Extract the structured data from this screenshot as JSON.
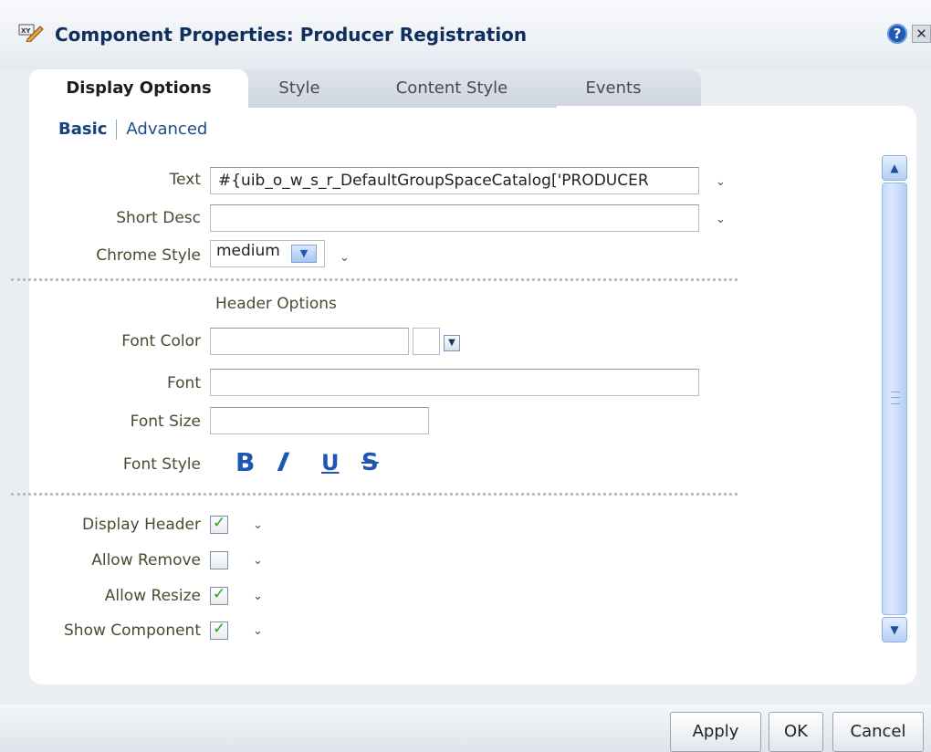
{
  "dialog": {
    "title": "Component Properties: Producer Registration",
    "help_icon": "?",
    "close_icon": "✕"
  },
  "tabs": [
    {
      "label": "Display Options",
      "active": true
    },
    {
      "label": "Style",
      "active": false
    },
    {
      "label": "Content Style",
      "active": false
    },
    {
      "label": "Events",
      "active": false
    }
  ],
  "subnav": {
    "basic": "Basic",
    "advanced": "Advanced"
  },
  "form": {
    "text_label": "Text",
    "text_value": "#{uib_o_w_s_r_DefaultGroupSpaceCatalog['PRODUCER",
    "short_desc_label": "Short Desc",
    "short_desc_value": "",
    "chrome_style_label": "Chrome Style",
    "chrome_style_value": "medium",
    "header_options_label": "Header Options",
    "font_color_label": "Font Color",
    "font_color_value": "",
    "font_label": "Font",
    "font_value": "",
    "font_size_label": "Font Size",
    "font_size_value": "",
    "font_style_label": "Font Style",
    "font_style_buttons": {
      "bold": "B",
      "italic": "I",
      "underline": "U",
      "strike": "S"
    },
    "display_header_label": "Display Header",
    "display_header_checked": true,
    "allow_remove_label": "Allow Remove",
    "allow_remove_checked": false,
    "allow_resize_label": "Allow Resize",
    "allow_resize_checked": true,
    "show_component_label": "Show Component",
    "show_component_checked": true
  },
  "icons": {
    "chevron": "⌄",
    "title_icon": "edit-properties-icon"
  },
  "buttons": {
    "apply": "Apply",
    "ok": "OK",
    "cancel": "Cancel"
  },
  "colors": {
    "accent": "#1d57b2",
    "title": "#0e2f5e",
    "check": "#1fa12a"
  }
}
